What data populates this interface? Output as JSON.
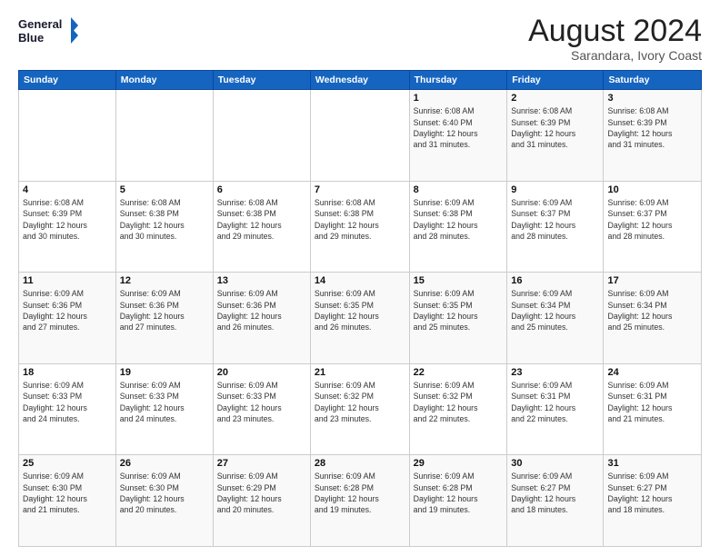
{
  "logo": {
    "line1": "General",
    "line2": "Blue"
  },
  "title": "August 2024",
  "subtitle": "Sarandara, Ivory Coast",
  "days_of_week": [
    "Sunday",
    "Monday",
    "Tuesday",
    "Wednesday",
    "Thursday",
    "Friday",
    "Saturday"
  ],
  "weeks": [
    [
      {
        "day": "",
        "info": ""
      },
      {
        "day": "",
        "info": ""
      },
      {
        "day": "",
        "info": ""
      },
      {
        "day": "",
        "info": ""
      },
      {
        "day": "1",
        "info": "Sunrise: 6:08 AM\nSunset: 6:40 PM\nDaylight: 12 hours\nand 31 minutes."
      },
      {
        "day": "2",
        "info": "Sunrise: 6:08 AM\nSunset: 6:39 PM\nDaylight: 12 hours\nand 31 minutes."
      },
      {
        "day": "3",
        "info": "Sunrise: 6:08 AM\nSunset: 6:39 PM\nDaylight: 12 hours\nand 31 minutes."
      }
    ],
    [
      {
        "day": "4",
        "info": "Sunrise: 6:08 AM\nSunset: 6:39 PM\nDaylight: 12 hours\nand 30 minutes."
      },
      {
        "day": "5",
        "info": "Sunrise: 6:08 AM\nSunset: 6:38 PM\nDaylight: 12 hours\nand 30 minutes."
      },
      {
        "day": "6",
        "info": "Sunrise: 6:08 AM\nSunset: 6:38 PM\nDaylight: 12 hours\nand 29 minutes."
      },
      {
        "day": "7",
        "info": "Sunrise: 6:08 AM\nSunset: 6:38 PM\nDaylight: 12 hours\nand 29 minutes."
      },
      {
        "day": "8",
        "info": "Sunrise: 6:09 AM\nSunset: 6:38 PM\nDaylight: 12 hours\nand 28 minutes."
      },
      {
        "day": "9",
        "info": "Sunrise: 6:09 AM\nSunset: 6:37 PM\nDaylight: 12 hours\nand 28 minutes."
      },
      {
        "day": "10",
        "info": "Sunrise: 6:09 AM\nSunset: 6:37 PM\nDaylight: 12 hours\nand 28 minutes."
      }
    ],
    [
      {
        "day": "11",
        "info": "Sunrise: 6:09 AM\nSunset: 6:36 PM\nDaylight: 12 hours\nand 27 minutes."
      },
      {
        "day": "12",
        "info": "Sunrise: 6:09 AM\nSunset: 6:36 PM\nDaylight: 12 hours\nand 27 minutes."
      },
      {
        "day": "13",
        "info": "Sunrise: 6:09 AM\nSunset: 6:36 PM\nDaylight: 12 hours\nand 26 minutes."
      },
      {
        "day": "14",
        "info": "Sunrise: 6:09 AM\nSunset: 6:35 PM\nDaylight: 12 hours\nand 26 minutes."
      },
      {
        "day": "15",
        "info": "Sunrise: 6:09 AM\nSunset: 6:35 PM\nDaylight: 12 hours\nand 25 minutes."
      },
      {
        "day": "16",
        "info": "Sunrise: 6:09 AM\nSunset: 6:34 PM\nDaylight: 12 hours\nand 25 minutes."
      },
      {
        "day": "17",
        "info": "Sunrise: 6:09 AM\nSunset: 6:34 PM\nDaylight: 12 hours\nand 25 minutes."
      }
    ],
    [
      {
        "day": "18",
        "info": "Sunrise: 6:09 AM\nSunset: 6:33 PM\nDaylight: 12 hours\nand 24 minutes."
      },
      {
        "day": "19",
        "info": "Sunrise: 6:09 AM\nSunset: 6:33 PM\nDaylight: 12 hours\nand 24 minutes."
      },
      {
        "day": "20",
        "info": "Sunrise: 6:09 AM\nSunset: 6:33 PM\nDaylight: 12 hours\nand 23 minutes."
      },
      {
        "day": "21",
        "info": "Sunrise: 6:09 AM\nSunset: 6:32 PM\nDaylight: 12 hours\nand 23 minutes."
      },
      {
        "day": "22",
        "info": "Sunrise: 6:09 AM\nSunset: 6:32 PM\nDaylight: 12 hours\nand 22 minutes."
      },
      {
        "day": "23",
        "info": "Sunrise: 6:09 AM\nSunset: 6:31 PM\nDaylight: 12 hours\nand 22 minutes."
      },
      {
        "day": "24",
        "info": "Sunrise: 6:09 AM\nSunset: 6:31 PM\nDaylight: 12 hours\nand 21 minutes."
      }
    ],
    [
      {
        "day": "25",
        "info": "Sunrise: 6:09 AM\nSunset: 6:30 PM\nDaylight: 12 hours\nand 21 minutes."
      },
      {
        "day": "26",
        "info": "Sunrise: 6:09 AM\nSunset: 6:30 PM\nDaylight: 12 hours\nand 20 minutes."
      },
      {
        "day": "27",
        "info": "Sunrise: 6:09 AM\nSunset: 6:29 PM\nDaylight: 12 hours\nand 20 minutes."
      },
      {
        "day": "28",
        "info": "Sunrise: 6:09 AM\nSunset: 6:28 PM\nDaylight: 12 hours\nand 19 minutes."
      },
      {
        "day": "29",
        "info": "Sunrise: 6:09 AM\nSunset: 6:28 PM\nDaylight: 12 hours\nand 19 minutes."
      },
      {
        "day": "30",
        "info": "Sunrise: 6:09 AM\nSunset: 6:27 PM\nDaylight: 12 hours\nand 18 minutes."
      },
      {
        "day": "31",
        "info": "Sunrise: 6:09 AM\nSunset: 6:27 PM\nDaylight: 12 hours\nand 18 minutes."
      }
    ]
  ]
}
